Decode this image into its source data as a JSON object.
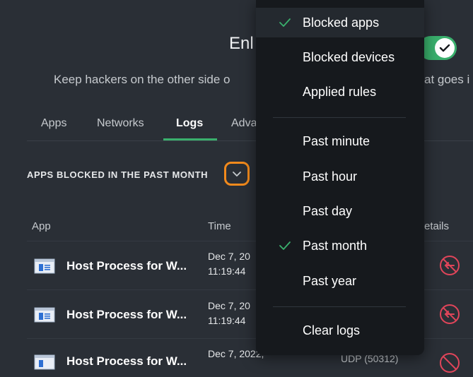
{
  "header": {
    "title": "Enl",
    "subtitle": "Keep hackers on the other side o",
    "subtitle_tail": "at goes i",
    "toggle_on": true
  },
  "tabs": [
    {
      "label": "Apps"
    },
    {
      "label": "Networks"
    },
    {
      "label": "Logs",
      "active": true
    },
    {
      "label": "Adva"
    }
  ],
  "logs": {
    "section_title": "APPS BLOCKED IN THE PAST MONTH",
    "columns": {
      "app": "App",
      "time": "Time",
      "details": "etails"
    },
    "rows": [
      {
        "app": "Host Process for W...",
        "time_line1": "Dec 7, 20",
        "time_line2": "11:19:44"
      },
      {
        "app": "Host Process for W...",
        "time_line1": "Dec 7, 20",
        "time_line2": "11:19:44"
      },
      {
        "app": "Host Process for W...",
        "time_line1": "Dec 7, 2022,",
        "time_line2": "",
        "protocol": "UDP (50312)"
      }
    ]
  },
  "dropdown": {
    "view_items": [
      {
        "label": "Blocked apps",
        "checked": true
      },
      {
        "label": "Blocked devices",
        "checked": false
      },
      {
        "label": "Applied rules",
        "checked": false
      }
    ],
    "period_items": [
      {
        "label": "Past minute",
        "checked": false
      },
      {
        "label": "Past hour",
        "checked": false
      },
      {
        "label": "Past day",
        "checked": false
      },
      {
        "label": "Past month",
        "checked": true
      },
      {
        "label": "Past year",
        "checked": false
      }
    ],
    "clear_label": "Clear logs"
  },
  "colors": {
    "accent": "#3ab06d",
    "focus_ring": "#f28a1c",
    "block_red": "#e0455a"
  }
}
